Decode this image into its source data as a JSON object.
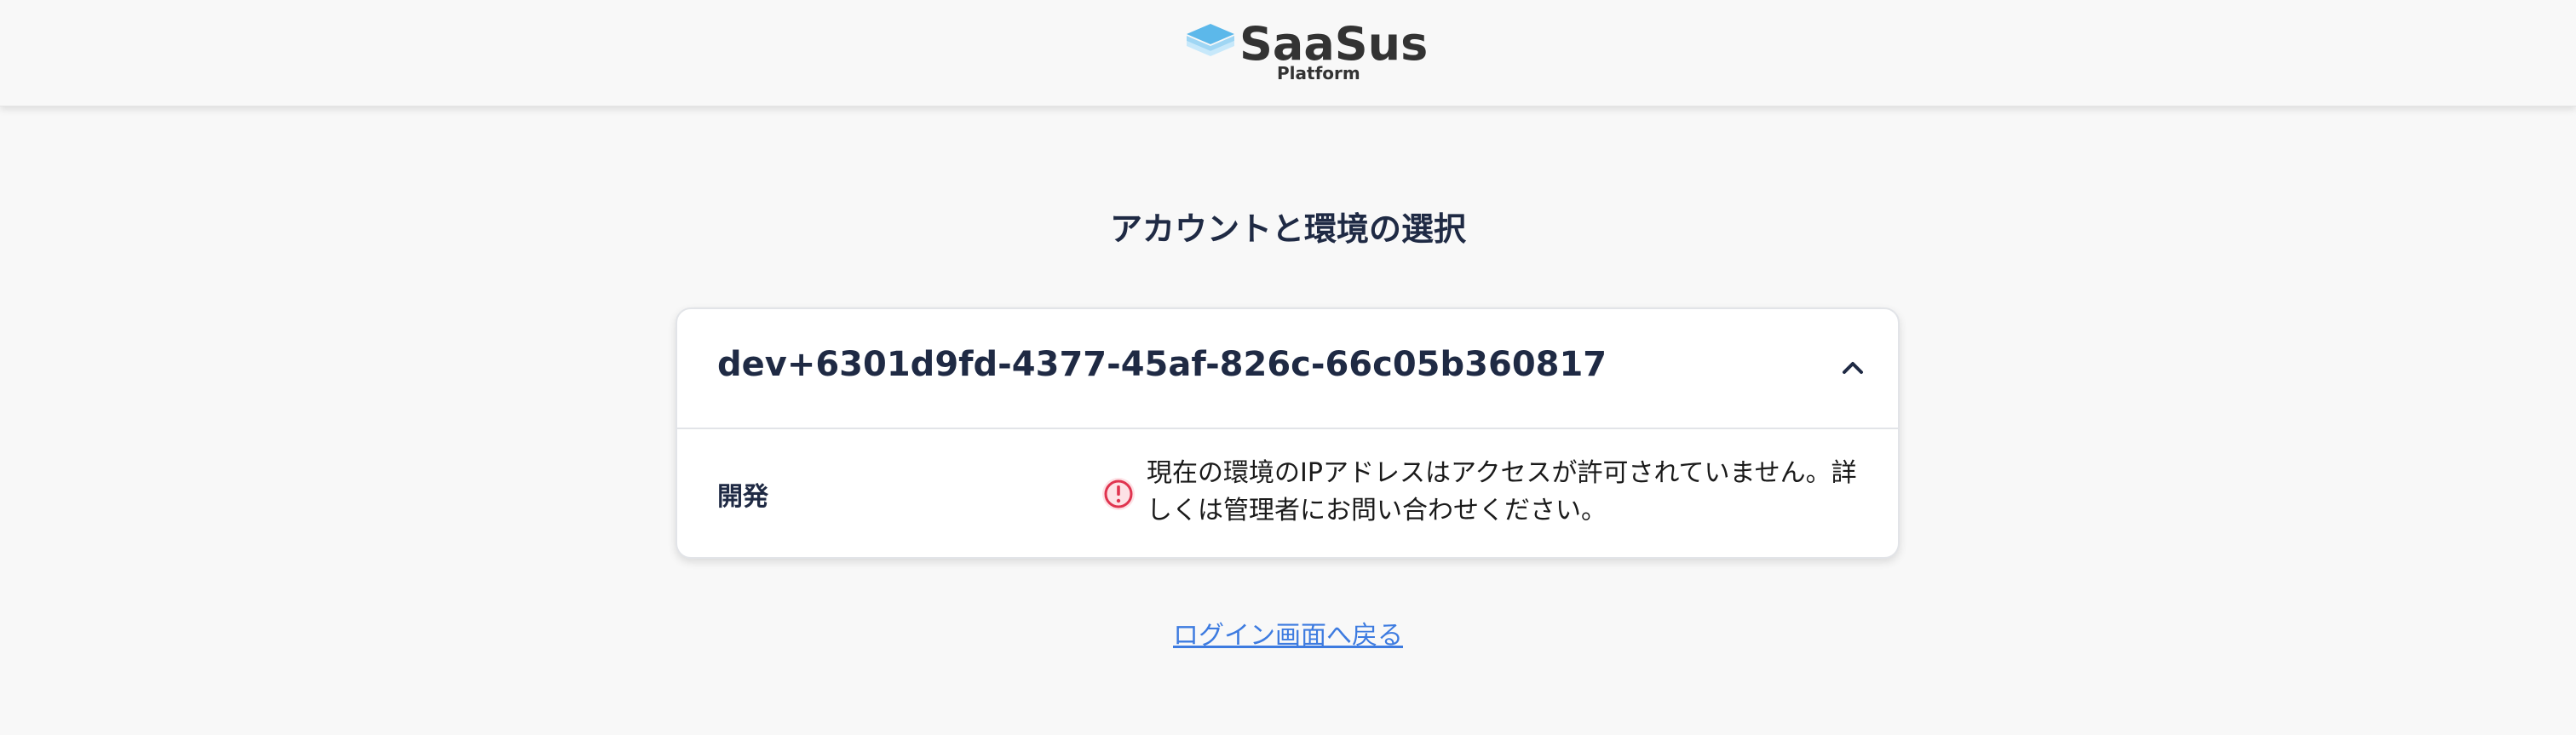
{
  "header": {
    "logo_name": "SaaSus",
    "logo_sub": "Platform"
  },
  "page_title": "アカウントと環境の選択",
  "account": {
    "id": "dev+6301d9fd-4377-45af-826c-66c05b360817",
    "expanded": true,
    "environments": [
      {
        "name": "開発",
        "status": "error",
        "message": "現在の環境のIPアドレスはアクセスが許可されていません。詳しくは管理者にお問い合わせください。"
      }
    ]
  },
  "back_link": "ログイン画面へ戻る",
  "icons": {
    "logo": "stacked-layers-logo-icon",
    "toggle": "chevron-up-icon",
    "status": "error-circle-icon"
  },
  "colors": {
    "logo_blue": "#5cb8ea",
    "error_red": "#e0344f",
    "link_blue": "#3d7be0",
    "text_dark": "#1f2a44"
  }
}
